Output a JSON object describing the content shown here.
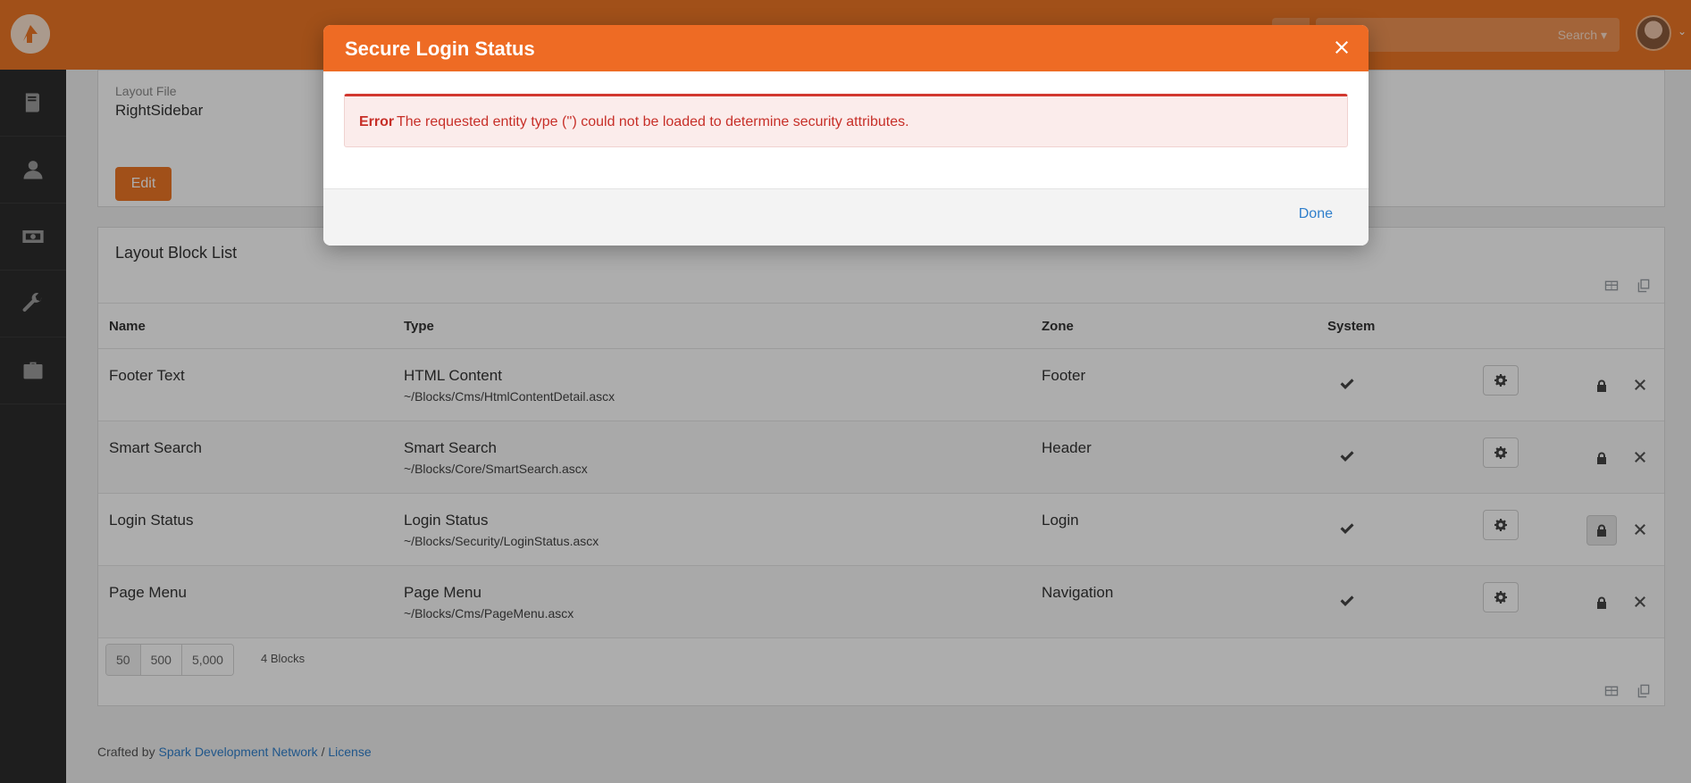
{
  "header": {
    "search_dropdown_label": "Search ▾"
  },
  "layout_panel": {
    "field_label": "Layout File",
    "field_value": "RightSidebar",
    "edit_label": "Edit"
  },
  "blocks": {
    "title": "Layout Block List",
    "columns": [
      "Name",
      "Type",
      "Zone",
      "System"
    ],
    "rows": [
      {
        "name": "Footer Text",
        "type": "HTML Content",
        "path": "~/Blocks/Cms/HtmlContentDetail.ascx",
        "zone": "Footer",
        "system": true
      },
      {
        "name": "Smart Search",
        "type": "Smart Search",
        "path": "~/Blocks/Core/SmartSearch.ascx",
        "zone": "Header",
        "system": true
      },
      {
        "name": "Login Status",
        "type": "Login Status",
        "path": "~/Blocks/Security/LoginStatus.ascx",
        "zone": "Login",
        "system": true
      },
      {
        "name": "Page Menu",
        "type": "Page Menu",
        "path": "~/Blocks/Cms/PageMenu.ascx",
        "zone": "Navigation",
        "system": true
      }
    ],
    "page_sizes": [
      "50",
      "500",
      "5,000"
    ],
    "count_label": "4 Blocks"
  },
  "footer": {
    "prefix": "Crafted by",
    "link1": "Spark Development Network",
    "separator": "/",
    "link2": "License"
  },
  "modal": {
    "title": "Secure Login Status",
    "alert_strong": "Error",
    "alert_message": "The requested entity type ('') could not be loaded to determine security attributes.",
    "done_label": "Done"
  },
  "icons": {
    "sidebar": [
      "book-icon",
      "person-icon",
      "money-icon",
      "wrench-icon",
      "briefcase-icon"
    ]
  },
  "colors": {
    "brand_orange": "#ee7625",
    "modal_header": "#ee6b24",
    "error_red": "#c72f28",
    "link_blue": "#2f7fcc",
    "sidebar_bg": "#2d2d2d"
  }
}
